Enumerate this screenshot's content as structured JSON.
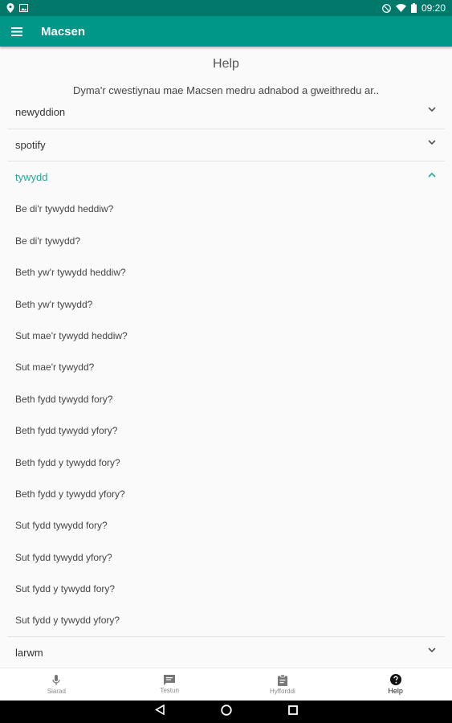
{
  "status_bar": {
    "time": "09:20"
  },
  "app_bar": {
    "title": "Macsen"
  },
  "help": {
    "title": "Help",
    "description": "Dyma'r cwestiynau mae Macsen medru adnabod a gweithredu ar.."
  },
  "sections": [
    {
      "label": "newyddion",
      "expanded": false
    },
    {
      "label": "spotify",
      "expanded": false
    },
    {
      "label": "tywydd",
      "expanded": true
    },
    {
      "label": "larwm",
      "expanded": false
    }
  ],
  "tywydd_questions": [
    "Be di'r tywydd heddiw?",
    "Be di'r tywydd?",
    "Beth yw'r tywydd heddiw?",
    "Beth yw'r tywydd?",
    "Sut mae'r tywydd heddiw?",
    "Sut mae'r tywydd?",
    "Beth fydd tywydd fory?",
    "Beth fydd tywydd yfory?",
    "Beth fydd y tywydd fory?",
    "Beth fydd y tywydd yfory?",
    "Sut fydd tywydd fory?",
    "Sut fydd tywydd yfory?",
    "Sut fydd y tywydd fory?",
    "Sut fydd y tywydd yfory?"
  ],
  "bottom_nav": [
    {
      "label": "Siarad",
      "icon": "mic-icon",
      "active": false
    },
    {
      "label": "Testun",
      "icon": "chat-icon",
      "active": false
    },
    {
      "label": "Hyfforddi",
      "icon": "clipboard-icon",
      "active": false
    },
    {
      "label": "Help",
      "icon": "help-icon",
      "active": true
    }
  ],
  "colors": {
    "primary": "#009688",
    "primary_dark": "#00796b",
    "accent": "#26a69a"
  }
}
